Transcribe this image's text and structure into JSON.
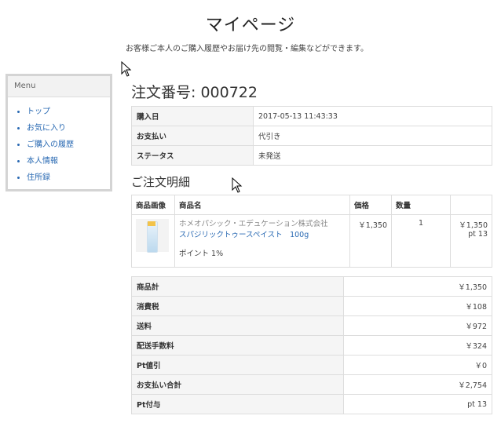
{
  "page": {
    "title": "マイページ",
    "subtitle": "お客様ご本人のご購入履歴やお届け先の閲覧・編集などができます。"
  },
  "menu": {
    "title": "Menu",
    "items": [
      {
        "label": "トップ"
      },
      {
        "label": "お気に入り"
      },
      {
        "label": "ご購入の履歴"
      },
      {
        "label": "本人情報"
      },
      {
        "label": "住所録"
      }
    ]
  },
  "order": {
    "title_label": "注文番号:",
    "number": "000722",
    "rows": [
      {
        "key": "購入日",
        "value": "2017-05-13 11:43:33"
      },
      {
        "key": "お支払い",
        "value": "代引き"
      },
      {
        "key": "ステータス",
        "value": "未発送"
      }
    ]
  },
  "details": {
    "title": "ご注文明細",
    "headers": {
      "image": "商品画像",
      "name": "商品名",
      "price": "価格",
      "qty": "数量",
      "total": ""
    },
    "items": [
      {
        "maker": "ホメオパシック・エデュケーション株式会社",
        "name": "スパジリックトゥースペイスト　100g",
        "points": "ポイント 1%",
        "price": "￥1,350",
        "qty": "1",
        "subtotal": "￥1,350",
        "pt": "pt 13",
        "image_icon": "toothpaste-tube-icon"
      }
    ]
  },
  "totals": [
    {
      "key": "商品計",
      "value": "￥1,350"
    },
    {
      "key": "消費税",
      "value": "￥108"
    },
    {
      "key": "送料",
      "value": "￥972"
    },
    {
      "key": "配送手数料",
      "value": "￥324"
    },
    {
      "key": "Pt値引",
      "value": "￥0"
    },
    {
      "key": "お支払い合計",
      "value": "￥2,754"
    },
    {
      "key": "Pt付与",
      "value": "pt 13"
    }
  ],
  "colors": {
    "link": "#2a6ab3",
    "header_bg": "#f5f5f5",
    "border": "#dddddd"
  },
  "icons": [
    "mouse-pointer-icon"
  ]
}
